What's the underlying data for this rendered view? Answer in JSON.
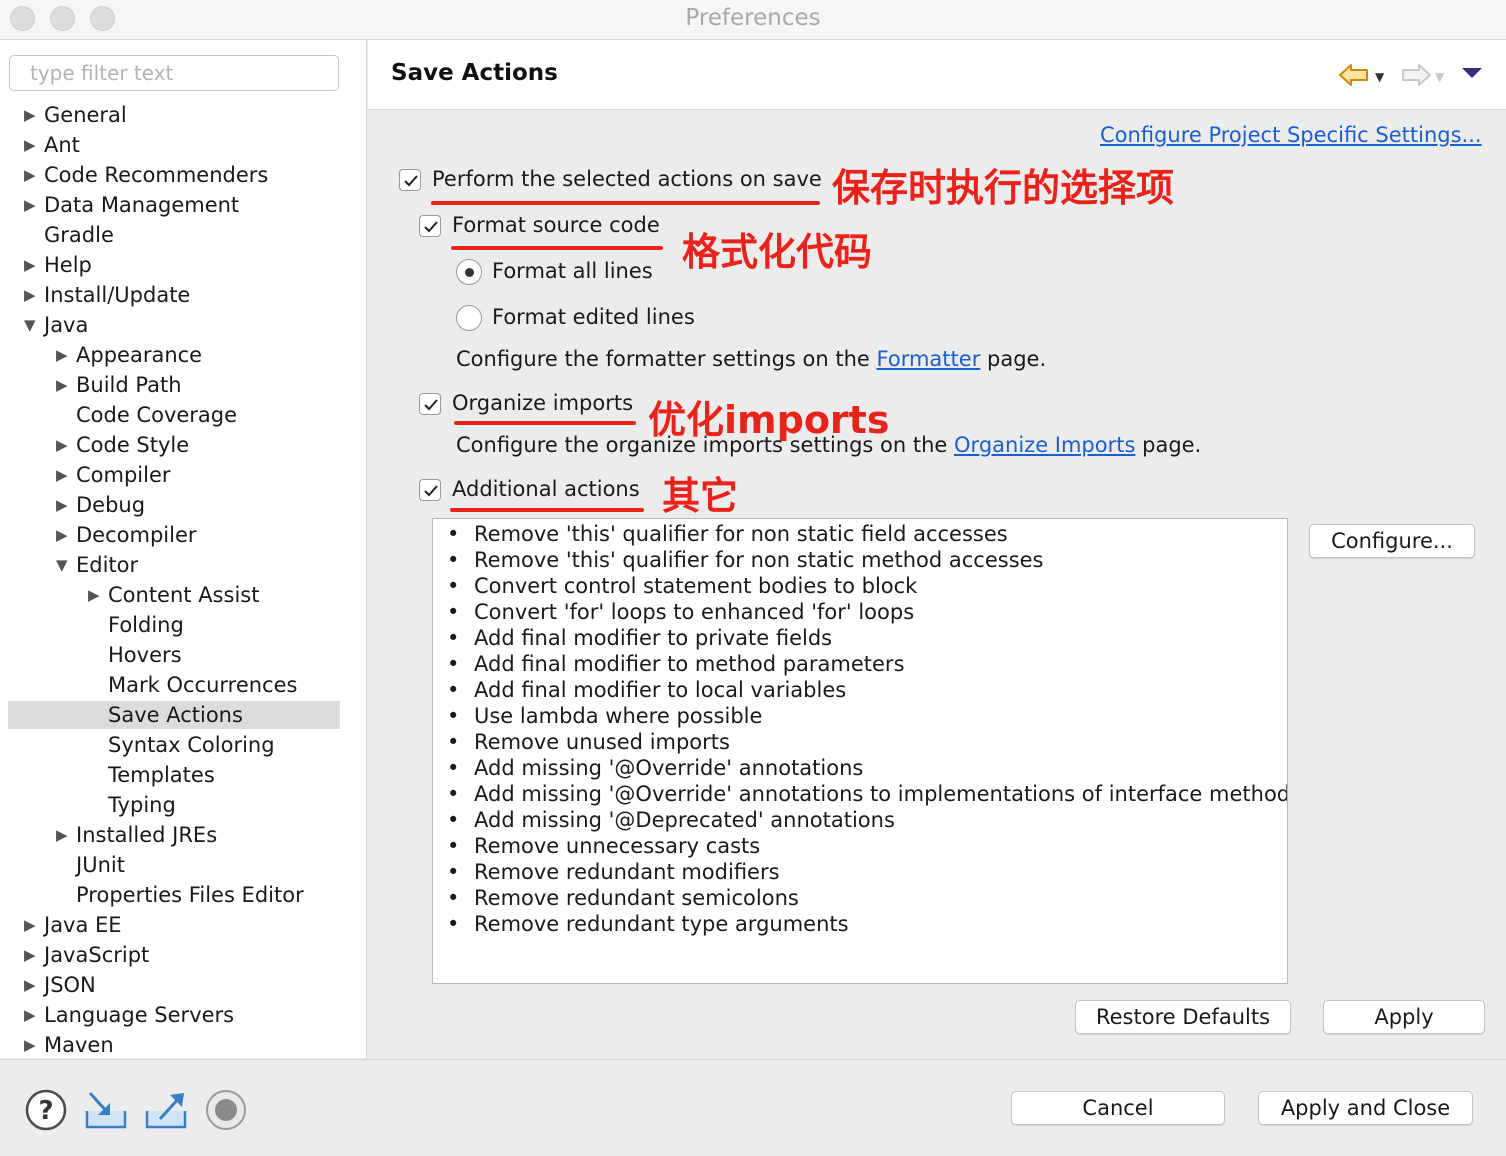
{
  "window": {
    "title": "Preferences"
  },
  "filter": {
    "placeholder": "type filter text"
  },
  "tree": [
    {
      "label": "General"
    },
    {
      "label": "Ant"
    },
    {
      "label": "Code Recommenders"
    },
    {
      "label": "Data Management"
    },
    {
      "label": "Gradle"
    },
    {
      "label": "Help"
    },
    {
      "label": "Install/Update"
    },
    {
      "label": "Java"
    },
    {
      "label": "Appearance"
    },
    {
      "label": "Build Path"
    },
    {
      "label": "Code Coverage"
    },
    {
      "label": "Code Style"
    },
    {
      "label": "Compiler"
    },
    {
      "label": "Debug"
    },
    {
      "label": "Decompiler"
    },
    {
      "label": "Editor"
    },
    {
      "label": "Content Assist"
    },
    {
      "label": "Folding"
    },
    {
      "label": "Hovers"
    },
    {
      "label": "Mark Occurrences"
    },
    {
      "label": "Save Actions"
    },
    {
      "label": "Syntax Coloring"
    },
    {
      "label": "Templates"
    },
    {
      "label": "Typing"
    },
    {
      "label": "Installed JREs"
    },
    {
      "label": "JUnit"
    },
    {
      "label": "Properties Files Editor"
    },
    {
      "label": "Java EE"
    },
    {
      "label": "JavaScript"
    },
    {
      "label": "JSON"
    },
    {
      "label": "Language Servers"
    },
    {
      "label": "Maven"
    }
  ],
  "page": {
    "title": "Save Actions",
    "project_link": "Configure Project Specific Settings...",
    "perform_label": "Perform the selected actions on save",
    "format_label": "Format source code",
    "format_all": "Format all lines",
    "format_edited": "Format edited lines",
    "formatter_pre": "Configure the formatter settings on the",
    "formatter_link": "Formatter",
    "formatter_post": "page.",
    "organize_label": "Organize imports",
    "organize_pre": "Configure the organize imports settings on the",
    "organize_link": "Organize Imports",
    "organize_post": "page.",
    "additional_label": "Additional actions",
    "bullet": "•",
    "actions": [
      "Remove 'this' qualifier for non static field accesses",
      "Remove 'this' qualifier for non static method accesses",
      "Convert control statement bodies to block",
      "Convert 'for' loops to enhanced 'for' loops",
      "Add final modifier to private fields",
      "Add final modifier to method parameters",
      "Add final modifier to local variables",
      "Use lambda where possible",
      "Remove unused imports",
      "Add missing '@Override' annotations",
      "Add missing '@Override' annotations to implementations of interface methods",
      "Add missing '@Deprecated' annotations",
      "Remove unnecessary casts",
      "Remove redundant modifiers",
      "Remove redundant semicolons",
      "Remove redundant type arguments"
    ],
    "configure_button": "Configure...",
    "restore_button": "Restore Defaults",
    "apply_button": "Apply"
  },
  "annotations": {
    "perform": "保存时执行的选择项",
    "format": "格式化代码",
    "organize": "优化imports",
    "additional": "其它"
  },
  "footer": {
    "cancel": "Cancel",
    "apply_close": "Apply and Close"
  },
  "colors": {
    "link": "#1a5fcf",
    "annotation": "#e8231c",
    "back_arrow": "#e2a313"
  },
  "icons": {
    "help": "help-icon",
    "import": "import-icon",
    "export": "export-icon",
    "record": "record-icon"
  }
}
